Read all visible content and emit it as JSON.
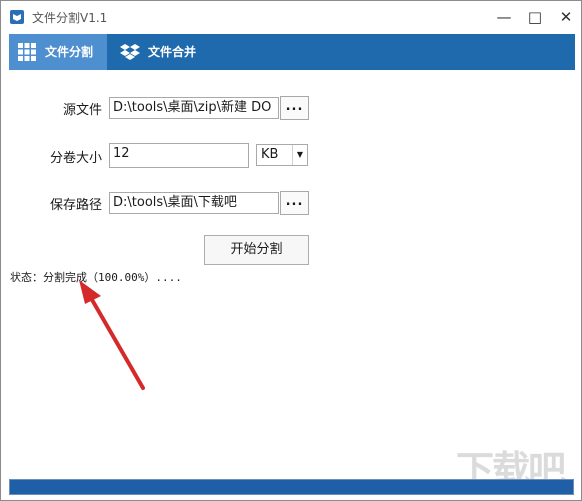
{
  "window": {
    "title": "文件分割V1.1",
    "controls": {
      "minimize": "—",
      "maximize": "□",
      "close": "✕"
    }
  },
  "tabs": [
    {
      "label": "文件分割",
      "icon": "grid-icon",
      "active": true
    },
    {
      "label": "文件合并",
      "icon": "dropbox-icon",
      "active": false
    }
  ],
  "form": {
    "source_label": "源文件",
    "source_value": "D:\\tools\\桌面\\zip\\新建 DO",
    "size_label": "分卷大小",
    "size_value": "12",
    "unit_value": "KB",
    "save_label": "保存路径",
    "save_value": "D:\\tools\\桌面\\下载吧",
    "browse_label": "...",
    "start_label": "开始分割"
  },
  "status": {
    "text": "状态：分割完成（100.00%）...."
  },
  "progress": {
    "value": 1.0
  },
  "watermark": "下载吧",
  "colors": {
    "tabbar": "#1e6aac",
    "active_tab": "#4e8fcf",
    "progress": "#1e5fa8",
    "arrow": "#d42a2a"
  }
}
